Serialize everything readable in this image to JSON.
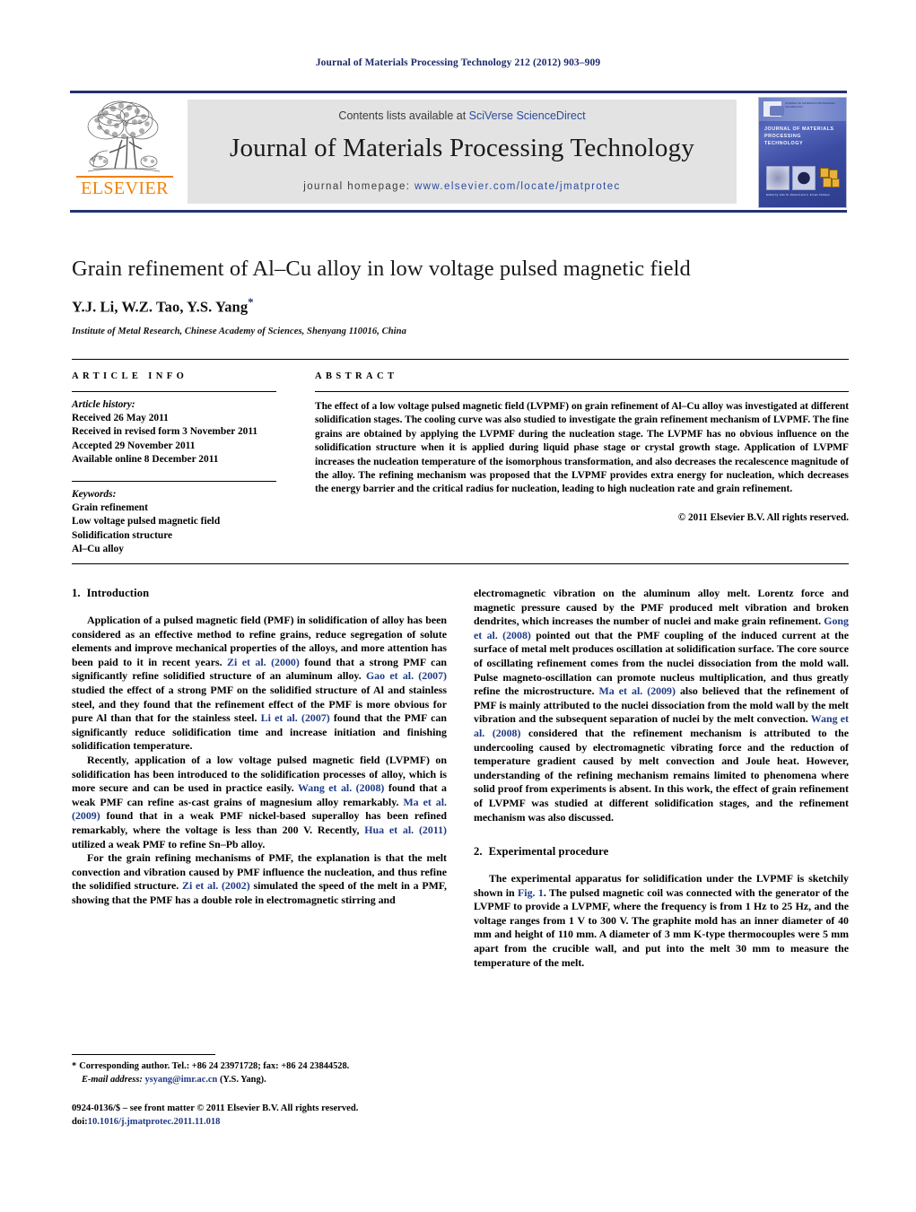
{
  "running_head": "Journal of Materials Processing Technology 212 (2012) 903–909",
  "masthead": {
    "contents_prefix": "Contents lists available at ",
    "contents_link": "SciVerse ScienceDirect",
    "journal_title": "Journal of Materials Processing Technology",
    "homepage_prefix": "journal homepage:",
    "homepage_url": "www.elsevier.com/locate/jmatprotec",
    "publisher_wordmark": "ELSEVIER",
    "accent_color": "#24336d",
    "link_color": "#2b4b9b",
    "elsevier_orange": "#f08100",
    "cover": {
      "micro_header": "JOURNAL OF MATERIALS PROCESSING TECHNOLOGY",
      "title": "JOURNAL OF MATERIALS PROCESSING TECHNOLOGY",
      "editors": "Edited by John M. Allwood and A. Erman Tekkaya"
    }
  },
  "article": {
    "title": "Grain refinement of Al–Cu alloy in low voltage pulsed magnetic field",
    "authors": "Y.J. Li, W.Z. Tao, Y.S. Yang",
    "corresponding_marker": "*",
    "affiliation": "Institute of Metal Research, Chinese Academy of Sciences, Shenyang 110016, China"
  },
  "article_info": {
    "heading": "ARTICLE INFO",
    "history_label": "Article history:",
    "history": [
      "Received 26 May 2011",
      "Received in revised form 3 November 2011",
      "Accepted 29 November 2011",
      "Available online 8 December 2011"
    ],
    "keywords_label": "Keywords:",
    "keywords": [
      "Grain refinement",
      "Low voltage pulsed magnetic field",
      "Solidification structure",
      "Al–Cu alloy"
    ]
  },
  "abstract": {
    "heading": "ABSTRACT",
    "text": "The effect of a low voltage pulsed magnetic field (LVPMF) on grain refinement of Al–Cu alloy was investigated at different solidification stages. The cooling curve was also studied to investigate the grain refinement mechanism of LVPMF. The fine grains are obtained by applying the LVPMF during the nucleation stage. The LVPMF has no obvious influence on the solidification structure when it is applied during liquid phase stage or crystal growth stage. Application of LVPMF increases the nucleation temperature of the isomorphous transformation, and also decreases the recalescence magnitude of the alloy. The refining mechanism was proposed that the LVPMF provides extra energy for nucleation, which decreases the energy barrier and the critical radius for nucleation, leading to high nucleation rate and grain refinement.",
    "copyright": "© 2011 Elsevier B.V. All rights reserved."
  },
  "sections": {
    "introduction": {
      "number": "1.",
      "title": "Introduction",
      "paragraphs": [
        {
          "runs": [
            {
              "t": "Application of a pulsed magnetic field (PMF) in solidification of alloy has been considered as an effective method to refine grains, reduce segregation of solute elements and improve mechanical properties of the alloys, and more attention has been paid to it in recent years. "
            },
            {
              "t": "Zi et al. (2000)",
              "ref": true
            },
            {
              "t": " found that a strong PMF can significantly refine solidified structure of an aluminum alloy. "
            },
            {
              "t": "Gao et al. (2007)",
              "ref": true
            },
            {
              "t": " studied the effect of a strong PMF on the solidified structure of Al and stainless steel, and they found that the refinement effect of the PMF is more obvious for pure Al than that for the stainless steel. "
            },
            {
              "t": "Li et al. (2007)",
              "ref": true
            },
            {
              "t": " found that the PMF can significantly reduce solidification time and increase initiation and finishing solidification temperature."
            }
          ]
        },
        {
          "runs": [
            {
              "t": "Recently, application of a low voltage pulsed magnetic field (LVPMF) on solidification has been introduced to the solidification processes of alloy, which is more secure and can be used in practice easily. "
            },
            {
              "t": "Wang et al. (2008)",
              "ref": true
            },
            {
              "t": " found that a weak PMF can refine as-cast grains of magnesium alloy remarkably. "
            },
            {
              "t": "Ma et al. (2009)",
              "ref": true
            },
            {
              "t": " found that in a weak PMF nickel-based superalloy has been refined remarkably, where the voltage is less than 200 V. Recently, "
            },
            {
              "t": "Hua et al. (2011)",
              "ref": true
            },
            {
              "t": " utilized a weak PMF to refine Sn–Pb alloy."
            }
          ]
        },
        {
          "runs": [
            {
              "t": "For the grain refining mechanisms of PMF, the explanation is that the melt convection and vibration caused by PMF influence the nucleation, and thus refine the solidified structure. "
            },
            {
              "t": "Zi et al. (2002)",
              "ref": true
            },
            {
              "t": " simulated the speed of the melt in a PMF, showing that the PMF has a double role in electromagnetic stirring and"
            }
          ]
        },
        {
          "runs": [
            {
              "t": "electromagnetic vibration on the aluminum alloy melt. Lorentz force and magnetic pressure caused by the PMF produced melt vibration and broken dendrites, which increases the number of nuclei and make grain refinement. "
            },
            {
              "t": "Gong et al. (2008)",
              "ref": true
            },
            {
              "t": " pointed out that the PMF coupling of the induced current at the surface of metal melt produces oscillation at solidification surface. The core source of oscillating refinement comes from the nuclei dissociation from the mold wall. Pulse magneto-oscillation can promote nucleus multiplication, and thus greatly refine the microstructure. "
            },
            {
              "t": "Ma et al. (2009)",
              "ref": true
            },
            {
              "t": " also believed that the refinement of PMF is mainly attributed to the nuclei dissociation from the mold wall by the melt vibration and the subsequent separation of nuclei by the melt convection. "
            },
            {
              "t": "Wang et al. (2008)",
              "ref": true
            },
            {
              "t": " considered that the refinement mechanism is attributed to the undercooling caused by electromagnetic vibrating force and the reduction of temperature gradient caused by melt convection and Joule heat. However, understanding of the refining mechanism remains limited to phenomena where solid proof from experiments is absent. In this work, the effect of grain refinement of LVPMF was studied at different solidification stages, and the refinement mechanism was also discussed."
            }
          ]
        }
      ]
    },
    "experimental": {
      "number": "2.",
      "title": "Experimental procedure",
      "paragraphs": [
        {
          "runs": [
            {
              "t": "The experimental apparatus for solidification under the LVPMF is sketchily shown in "
            },
            {
              "t": "Fig. 1",
              "ref": true
            },
            {
              "t": ". The pulsed magnetic coil was connected with the generator of the LVPMF to provide a LVPMF, where the frequency is from 1 Hz to 25 Hz, and the voltage ranges from 1 V to 300 V. The graphite mold has an inner diameter of 40 mm and height of 110 mm. A diameter of 3 mm K-type thermocouples were 5 mm apart from the crucible wall, and put into the melt 30 mm to measure the temperature of the melt."
            }
          ]
        }
      ]
    }
  },
  "footnote": {
    "star": "*",
    "corresponding": "Corresponding author. Tel.: +86 24 23971728; fax: +86 24 23844528.",
    "email_label": "E-mail address:",
    "email": "ysyang@imr.ac.cn",
    "email_suffix": "(Y.S. Yang)."
  },
  "colophon": {
    "issn_line": "0924-0136/$ – see front matter © 2011 Elsevier B.V. All rights reserved.",
    "doi_label": "doi:",
    "doi": "10.1016/j.jmatprotec.2011.11.018"
  }
}
